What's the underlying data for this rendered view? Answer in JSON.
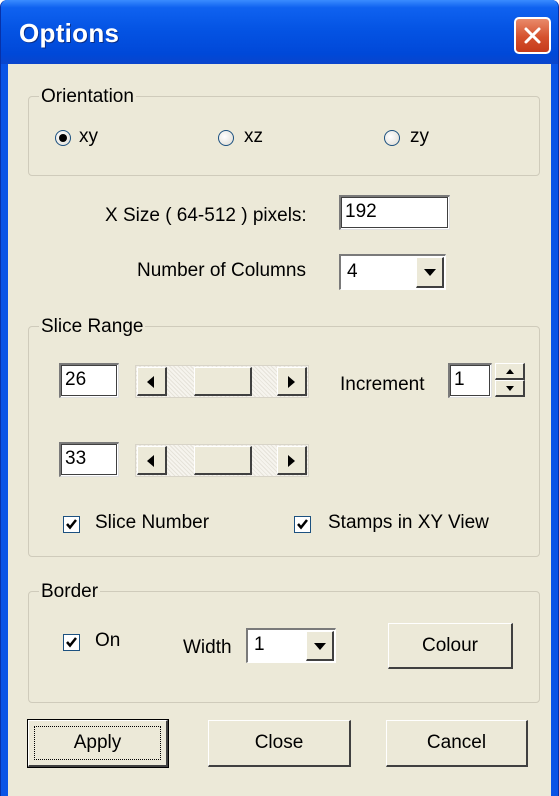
{
  "window": {
    "title": "Options"
  },
  "orientation": {
    "legend": "Orientation",
    "options": [
      {
        "label": "xy",
        "selected": true
      },
      {
        "label": "xz",
        "selected": false
      },
      {
        "label": "zy",
        "selected": false
      }
    ]
  },
  "x_size": {
    "label": "X Size ( 64-512 ) pixels:",
    "value": "192"
  },
  "columns": {
    "label": "Number of  Columns",
    "value": "4"
  },
  "slice_range": {
    "legend": "Slice Range",
    "start": {
      "value": "26",
      "slider_fraction": 0.25
    },
    "end": {
      "value": "33",
      "slider_fraction": 0.25
    },
    "increment": {
      "label": "Increment",
      "value": "1"
    },
    "slice_number": {
      "label": "Slice Number",
      "checked": true
    },
    "stamps_xy": {
      "label": "Stamps in XY View",
      "checked": true
    }
  },
  "border": {
    "legend": "Border",
    "on": {
      "label": "On",
      "checked": true
    },
    "width": {
      "label": "Width",
      "value": "1"
    },
    "colour_label": "Colour"
  },
  "buttons": {
    "apply": "Apply",
    "close": "Close",
    "cancel": "Cancel"
  }
}
